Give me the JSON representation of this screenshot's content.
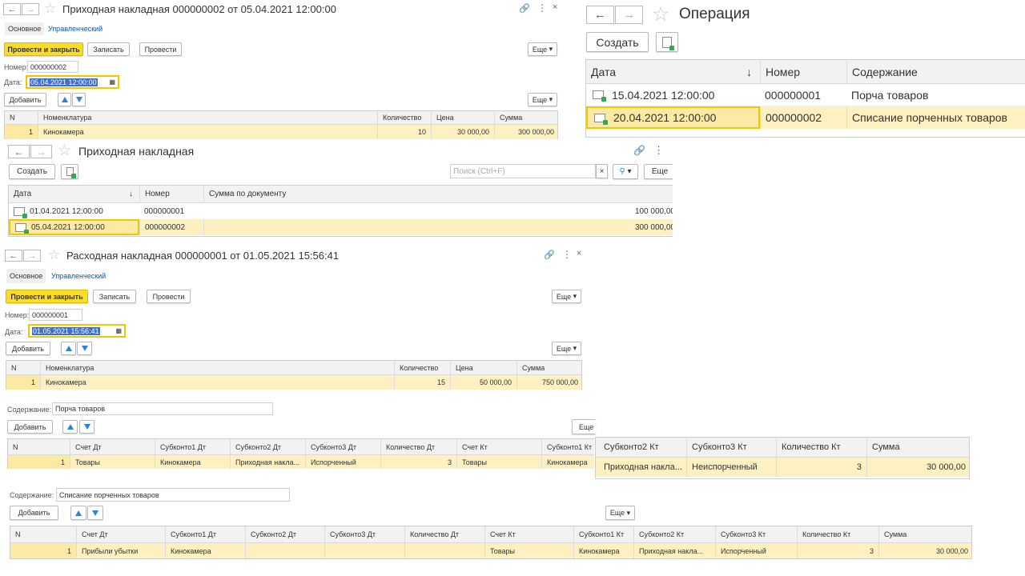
{
  "w1": {
    "title": "Приходная накладная 000000002 от 05.04.2021 12:00:00",
    "tabs": [
      "Основное",
      "Управленческий"
    ],
    "btn_post_close": "Провести и закрыть",
    "btn_save": "Записать",
    "btn_post": "Провести",
    "btn_more": "Еще",
    "num_label": "Номер:",
    "num_value": "000000002",
    "date_label": "Дата:",
    "date_value": "05.04.2021 12:00:00",
    "btn_add": "Добавить",
    "btn_more2": "Еще",
    "cols": [
      "N",
      "Номенклатура",
      "Количество",
      "Цена",
      "Сумма"
    ],
    "row": [
      "1",
      "Кинокамера",
      "10",
      "30 000,00",
      "300 000,00"
    ]
  },
  "w2": {
    "title": "Операция",
    "btn_create": "Создать",
    "cols": [
      "Дата",
      "Номер",
      "Содержание"
    ],
    "rows": [
      [
        "15.04.2021 12:00:00",
        "000000001",
        "Порча товаров"
      ],
      [
        "20.04.2021 12:00:00",
        "000000002",
        "Списание порченных товаров"
      ]
    ]
  },
  "w3": {
    "title": "Приходная накладная",
    "btn_create": "Создать",
    "search_placeholder": "Поиск (Ctrl+F)",
    "btn_more": "Еще",
    "cols": [
      "Дата",
      "Номер",
      "Сумма по документу"
    ],
    "rows": [
      [
        "01.04.2021 12:00:00",
        "000000001",
        "100 000,00"
      ],
      [
        "05.04.2021 12:00:00",
        "000000002",
        "300 000,00"
      ]
    ]
  },
  "w4": {
    "title": "Расходная накладная 000000001 от 01.05.2021 15:56:41",
    "tabs": [
      "Основное",
      "Управленческий"
    ],
    "btn_post_close": "Провести и закрыть",
    "btn_save": "Записать",
    "btn_post": "Провести",
    "btn_more": "Еще",
    "num_label": "Номер:",
    "num_value": "000000001",
    "date_label": "Дата:",
    "date_value": "01.05.2021 15:56:41",
    "btn_add": "Добавить",
    "btn_more2": "Еще",
    "cols": [
      "N",
      "Номенклатура",
      "Количество",
      "Цена",
      "Сумма"
    ],
    "row": [
      "1",
      "Кинокамера",
      "15",
      "50 000,00",
      "750 000,00"
    ]
  },
  "op1": {
    "content_label": "Содержание:",
    "content_value": "Порча товаров",
    "btn_add": "Добавить",
    "btn_more": "Еще",
    "cols": [
      "N",
      "Счет Дт",
      "Субконто1 Дт",
      "Субконто2 Дт",
      "Субконто3 Дт",
      "Количество Дт",
      "Счет Кт",
      "Субконто1 Кт"
    ],
    "row": [
      "1",
      "Товары",
      "Кинокамера",
      "Приходная накла...",
      "Испорченный",
      "3",
      "Товары",
      "Кинокамера"
    ],
    "cols_b": [
      "Субконто2 Кт",
      "Субконто3 Кт",
      "Количество Кт",
      "Сумма"
    ],
    "row_b": [
      "Приходная накла...",
      "Неиспорченный",
      "3",
      "30 000,00"
    ]
  },
  "op2": {
    "content_label": "Содержание:",
    "content_value": "Списание порченных товаров",
    "btn_add": "Добавить",
    "btn_more": "Еще",
    "cols": [
      "N",
      "Счет Дт",
      "Субконто1 Дт",
      "Субконто2 Дт",
      "Субконто3 Дт",
      "Количество Дт",
      "Счет Кт",
      "Субконто1 Кт",
      "Субконто2 Кт",
      "Субконто3 Кт",
      "Количество Кт",
      "Сумма"
    ],
    "row": [
      "1",
      "Прибыли убытки",
      "Кинокамера",
      "",
      "",
      "",
      "Товары",
      "Кинокамера",
      "Приходная накла...",
      "Испорченный",
      "3",
      "30 000,00"
    ]
  }
}
